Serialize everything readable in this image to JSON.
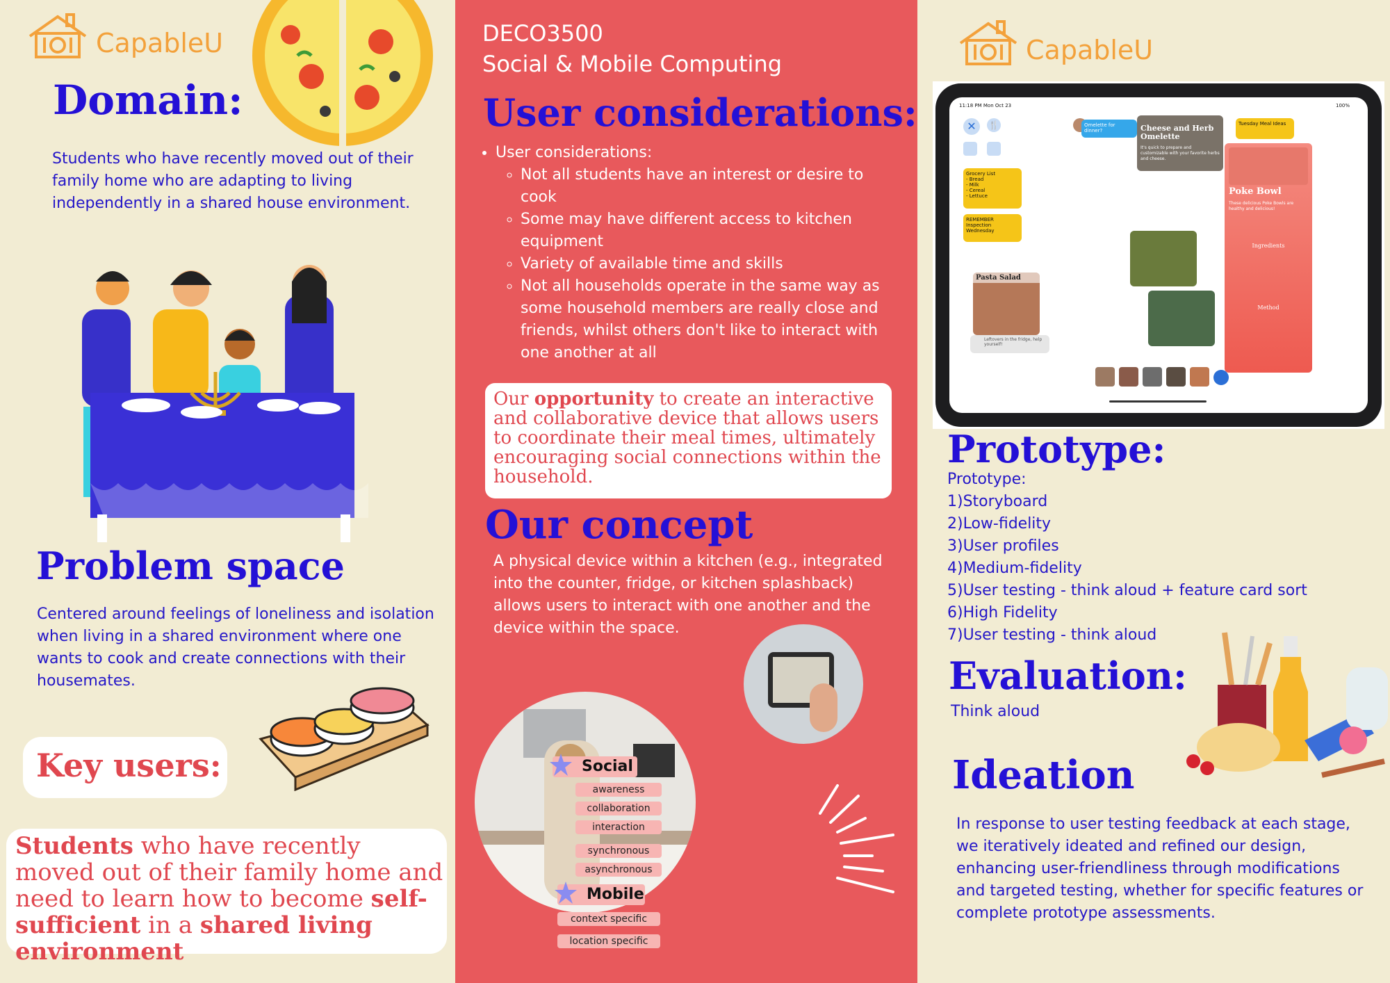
{
  "left": {
    "logo_text": "CapableU",
    "domain_heading": "Domain:",
    "domain_text": "Students who have recently moved out of their family home who are adapting to living independently in a shared house environment.",
    "problem_heading": "Problem space",
    "problem_text": "Centered around feelings of loneliness and isolation when living in a shared environment where one wants to cook and create connections with their housemates.",
    "key_users_heading": "Key users:",
    "key_users_text": {
      "b1": "Students",
      "t1": " who have recently moved out of their family home and need to learn how to become ",
      "b2": "self-sufficient",
      "t2": " in a ",
      "b3": "shared living environment"
    }
  },
  "middle": {
    "course_code": "DECO3500",
    "course_name": "Social & Mobile Computing",
    "user_heading": "User considerations:",
    "bullet_main": "User considerations:",
    "bullets": [
      "Not all students have an interest or desire to cook",
      "Some may have different access to kitchen equipment",
      "Variety of available time and skills",
      "Not all households operate in the same way as some household members are really close and friends, whilst others don't like to interact with one another at all"
    ],
    "opportunity": {
      "pre": "Our ",
      "bold": "opportunity",
      "post": " to create an interactive and collaborative device that allows users to coordinate their meal times, ultimately encouraging social connections within the household."
    },
    "concept_heading": "Our concept",
    "concept_text": "A physical device within a kitchen (e.g., integrated into the counter, fridge, or kitchen splashback) allows users to interact with one another and the device within the space.",
    "social_label": "Social",
    "social_tags": [
      "awareness",
      "collaboration",
      "interaction",
      "synchronous",
      "asynchronous"
    ],
    "mobile_label": "Mobile",
    "mobile_tags": [
      "context specific",
      "location specific"
    ]
  },
  "right": {
    "logo_text": "CapableU",
    "tablet": {
      "status_time": "11:18 PM   Mon Oct 23",
      "status_battery": "100%",
      "chat_bubble": "Omelette for dinner?",
      "omelette_title": "Cheese and Herb Omelette",
      "omelette_text": "It's quick to prepare and customizable with your favorite herbs and cheese.",
      "tuesday_note": "Tuesday Meal Ideas",
      "grocery_note": "Grocery List\n- Bread\n- Milk\n- Cereal\n- Lettuce",
      "reminder_note": "REMEMBER\nInspection\nWednesday",
      "poke_title": "Poke Bowl",
      "poke_text": "These delicious Poke Bowls are healthy and delicious!",
      "ingredients_title": "Ingredients",
      "method_title": "Method",
      "pasta_title": "Pasta Salad",
      "leftovers_text": "Leftovers in the fridge, help yourself!"
    },
    "prototype_heading": "Prototype:",
    "prototype_intro": "Prototype:",
    "prototype_steps": [
      "1)Storyboard",
      "2)Low-fidelity",
      "3)User profiles",
      "4)Medium-fidelity",
      "5)User testing - think aloud + feature card sort",
      "6)High Fidelity",
      "7)User testing - think aloud"
    ],
    "evaluation_heading": "Evaluation:",
    "evaluation_text": "Think aloud",
    "ideation_heading": "Ideation",
    "ideation_text": "In response to user testing feedback at each stage, we iteratively ideated and refined our design, enhancing user-friendliness through modifications and targeted testing, whether for specific features or complete prototype assessments."
  },
  "colors": {
    "cream": "#f2ecd3",
    "coral": "#e8595c",
    "heading_blue": "#2410d6",
    "logo_orange": "#f3a13b",
    "key_users_red": "#e0474f"
  }
}
